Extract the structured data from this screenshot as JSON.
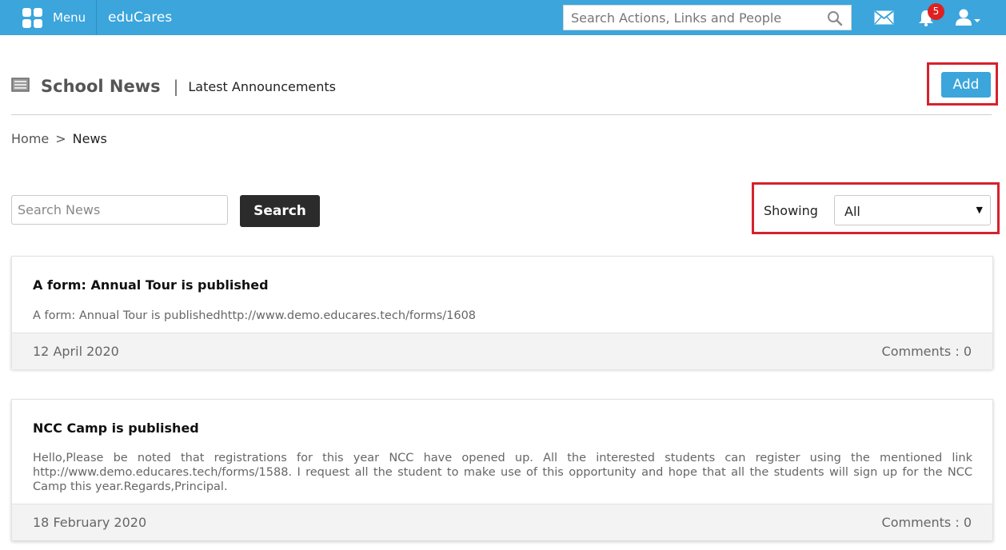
{
  "topbar": {
    "menu_label": "Menu",
    "brand": "eduCares",
    "search_placeholder": "Search Actions, Links and People",
    "notification_count": "5"
  },
  "header": {
    "title": "School News",
    "separator": "|",
    "subtitle": "Latest Announcements",
    "add_label": "Add"
  },
  "breadcrumb": {
    "home": "Home",
    "separator": ">",
    "current": "News"
  },
  "filters": {
    "search_placeholder": "Search News",
    "search_button": "Search",
    "showing_label": "Showing",
    "showing_value": "All"
  },
  "news": [
    {
      "title": "A form: Annual Tour is published",
      "body": "A form: Annual Tour is publishedhttp://www.demo.educares.tech/forms/1608",
      "date": "12 April 2020",
      "comments": "Comments : 0"
    },
    {
      "title": "NCC Camp is published",
      "body": "Hello,Please be noted that registrations for this year NCC have opened up. All the interested students can register using the mentioned link http://www.demo.educares.tech/forms/1588. I request all the student to make use of this opportunity and hope that all the students will sign up for the NCC Camp this year.Regards,Principal.",
      "date": "18 February 2020",
      "comments": "Comments : 0"
    }
  ],
  "colors": {
    "topbar": "#3ba5dc",
    "highlight_outline": "#d6222d",
    "search_button": "#2b2b2b",
    "badge": "#e02020"
  }
}
